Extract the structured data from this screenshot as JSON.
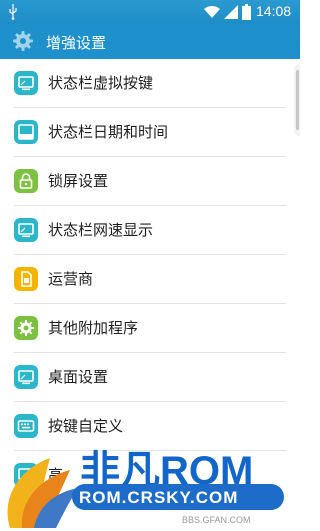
{
  "status_bar": {
    "time": "14:08",
    "icons": [
      "usb-icon",
      "wifi-icon",
      "signal-icon",
      "battery-icon"
    ]
  },
  "action_bar": {
    "title": "增強设置",
    "icon": "gear-icon"
  },
  "menu": {
    "items": [
      {
        "label": "状态栏虚拟按键",
        "icon": "screen-icon",
        "color": "#2bb6c9"
      },
      {
        "label": "状态栏日期和时间",
        "icon": "screen-icon",
        "color": "#2bb6c9"
      },
      {
        "label": "锁屏设置",
        "icon": "lock-icon",
        "color": "#7cc142"
      },
      {
        "label": "状态栏网速显示",
        "icon": "screen-icon",
        "color": "#2bb6c9"
      },
      {
        "label": "运营商",
        "icon": "sim-card-icon",
        "color": "#f5b400"
      },
      {
        "label": "其他附加程序",
        "icon": "gear-icon",
        "color": "#7cc142"
      },
      {
        "label": "桌面设置",
        "icon": "screen-icon",
        "color": "#2bb6c9"
      },
      {
        "label": "按键自定义",
        "icon": "keyboard-icon",
        "color": "#2bb6c9"
      },
      {
        "label": "高",
        "icon": "screen-icon",
        "color": "#2bb6c9"
      }
    ]
  },
  "watermark": {
    "logo_text": "非凡ROM",
    "url_text": "ROM.CRSKY.COM",
    "small_text": "BBS.GFAN.COM"
  },
  "colors": {
    "status_bar": "#2a9ad0",
    "action_bar": "#1e90cc",
    "teal": "#2bb6c9",
    "green": "#7cc142",
    "yellow": "#f5b400"
  }
}
